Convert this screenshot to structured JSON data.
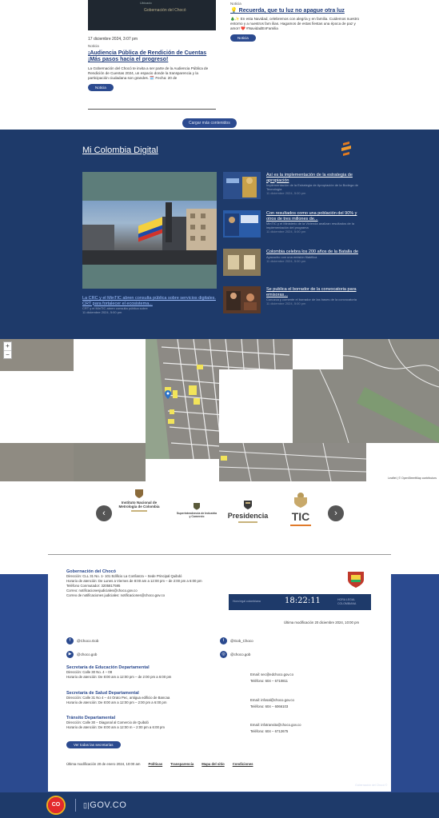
{
  "news": {
    "card1": {
      "image_caption_top": "Ubicado",
      "image_logo": "Gobernación del Chocó",
      "date": "17 diciembre 2024, 3:07 pm",
      "tag": "Noticia",
      "title": "¡Audiencia Pública de Rendición de Cuentas ¡Más pasos hacia el progreso!",
      "body": "La Gobernación del Chocó te invita a ser parte de la Audiencia Pública de Rendición de Cuentas 2024, un espacio donde la transparencia y la participación ciudadana son grandes. 🗓️ Fecha: 20 de",
      "button": "Noticia"
    },
    "card2": {
      "tag": "Noticia",
      "title": "💡 Recuerda, que tu luz no apague otra luz",
      "body": "🎄✨ En esta Navidad, celebremos con alegría y en familia. Cuidemos nuestro entorno y a nuestros fam ilias. Hagamos de estas fiestas una época de paz y amor! ❤️ #NavidadEnFamilia",
      "button": "Noticia"
    },
    "load_more": "Cargar más contenidos"
  },
  "mcd": {
    "title": "Mi Colombia Digital",
    "main": {
      "title": "La CRC y el MinTIC abren consulta pública sobre servicios digitales. CRT para fortalecer el ecosistema...",
      "summary": "CRT y el MinTIC abren consulta pública sobre",
      "date": "11 diciembre 2024, 5:00 pm"
    },
    "items": [
      {
        "title": "Así es la implementación de la estrategia de apropiación",
        "summary": "Implementación de la Estrategia de Apropiación de la Bodega de Tecnología",
        "date": "11 diciembre 2024, 5:00 pm"
      },
      {
        "title": "Con resultados como una población del 90% y otros de tres millones de...",
        "summary": "MinTIC y el Ministerio de la Vivienda analizan resultados de la implementación del programa",
        "date": "11 diciembre 2024, 5:00 pm"
      },
      {
        "title": "Colombia celebra los 200 años de la Batalla de",
        "summary": "Ayacucho con una emisión filatélica",
        "date": "11 diciembre 2024, 5:00 pm"
      },
      {
        "title": "Se publica el borrador de la convocatoria para emisoras...",
        "summary": "Conozca y comente el borrador de las bases de la convocatoria",
        "date": "11 diciembre 2024, 5:00 pm"
      }
    ]
  },
  "map": {
    "zoom_in": "+",
    "zoom_out": "−",
    "attribution": "Leaflet | © OpenStreetMap contributors"
  },
  "partners": {
    "prev": "‹",
    "next": "›",
    "items": [
      {
        "name": "Instituto Nacional de Metrología de Colombia"
      },
      {
        "name": "Superintendencia de Industria y Comercio"
      },
      {
        "name": "Presidencia"
      },
      {
        "name": "TIC"
      }
    ]
  },
  "footer": {
    "org": "Gobernación del Chocó",
    "lines": [
      "Dirección: CLL 31 No. 1- 101 Edificio La Confianza – Sede Principal Quibdó",
      "Horario de atención: De Lunes a Viernes de 8:00 am a 12:00 pm – de 2:00 pm a 6:00 pm",
      "Teléfono Conmutador: 3205817595",
      "Correo: notificacionesjudiciales@choco.gov.co",
      "Correo de notificaciones judiciales: notificaciones@choco.gov.co"
    ],
    "clock_time": "18:22:11",
    "clock_label": "Hora legal colombiana",
    "clock_label2": "HORA LEGAL COLOMBIANA",
    "modified": "Última modificación 20 diciembre 2024, 10:00 pm",
    "social": [
      "@Choco.Gob",
      "@Gob_Choco",
      "@choco.gob",
      "@choco.gob"
    ],
    "depts": [
      {
        "title": "Secretaría de Educación Departamental",
        "addr": "Dirección: Calle 30 No. 4 – 08",
        "hours": "Horario de atención: De 8:00 am a 12:00 pm – de 2:00 pm a 6:00 pm",
        "email": "Email: sec@edchoco.gov.co",
        "phone": "Teléfono: 604 – 6710811"
      },
      {
        "title": "Secretaría de Salud Departamental",
        "addr": "Dirección: Calle 31 No 4 – 44 Orato Pec, antigua edificio de Bancaa",
        "hours": "Horario de atención: De 8:00 am a 12:00 pm – 2:00 pm a 6:00 pm",
        "email": "Email: infosal@choco.gov.co",
        "phone": "Teléfono: 604 – 6066103"
      },
      {
        "title": "Tránsito Departamental",
        "addr": "Dirección: Calle 30 – Diagonal al Comercio de Quibdó",
        "hours": "Horario de atención: De 8:00 am a 12:00 m – 2:00 pm a 6:00 pm",
        "email": "Email: infotransito@choco.gov.co",
        "phone": "Teléfono: 604 – 6712675"
      }
    ],
    "all_depts_button": "Ver todas las secretarías",
    "bottom_modified": "Última modificación 20 de enero 2024, 10:00 am",
    "links": [
      "Políticas",
      "Transparencia",
      "Mapa del sitio",
      "Condiciones"
    ],
    "right_small": "Gobernación del Chocó ©",
    "co_badge": "CO",
    "gov_text": "GOV.CO"
  },
  "colors": {
    "navy": "#1e3a6a",
    "blue": "#2b4a8f",
    "gold": "#c8b27b",
    "flag_yellow": "#f4d03f",
    "flag_blue": "#1f4aa8",
    "flag_red": "#d2332a"
  }
}
